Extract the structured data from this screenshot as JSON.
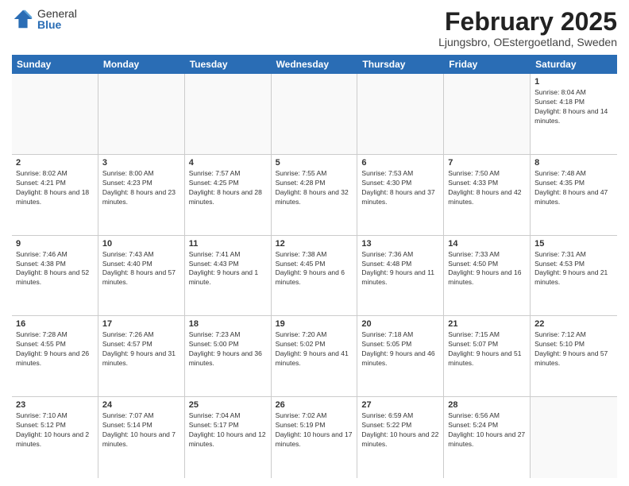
{
  "header": {
    "logo_general": "General",
    "logo_blue": "Blue",
    "month_year": "February 2025",
    "location": "Ljungsbro, OEstergoetland, Sweden"
  },
  "days_of_week": [
    "Sunday",
    "Monday",
    "Tuesday",
    "Wednesday",
    "Thursday",
    "Friday",
    "Saturday"
  ],
  "weeks": [
    [
      {
        "day": "",
        "info": ""
      },
      {
        "day": "",
        "info": ""
      },
      {
        "day": "",
        "info": ""
      },
      {
        "day": "",
        "info": ""
      },
      {
        "day": "",
        "info": ""
      },
      {
        "day": "",
        "info": ""
      },
      {
        "day": "1",
        "info": "Sunrise: 8:04 AM\nSunset: 4:18 PM\nDaylight: 8 hours and 14 minutes."
      }
    ],
    [
      {
        "day": "2",
        "info": "Sunrise: 8:02 AM\nSunset: 4:21 PM\nDaylight: 8 hours and 18 minutes."
      },
      {
        "day": "3",
        "info": "Sunrise: 8:00 AM\nSunset: 4:23 PM\nDaylight: 8 hours and 23 minutes."
      },
      {
        "day": "4",
        "info": "Sunrise: 7:57 AM\nSunset: 4:25 PM\nDaylight: 8 hours and 28 minutes."
      },
      {
        "day": "5",
        "info": "Sunrise: 7:55 AM\nSunset: 4:28 PM\nDaylight: 8 hours and 32 minutes."
      },
      {
        "day": "6",
        "info": "Sunrise: 7:53 AM\nSunset: 4:30 PM\nDaylight: 8 hours and 37 minutes."
      },
      {
        "day": "7",
        "info": "Sunrise: 7:50 AM\nSunset: 4:33 PM\nDaylight: 8 hours and 42 minutes."
      },
      {
        "day": "8",
        "info": "Sunrise: 7:48 AM\nSunset: 4:35 PM\nDaylight: 8 hours and 47 minutes."
      }
    ],
    [
      {
        "day": "9",
        "info": "Sunrise: 7:46 AM\nSunset: 4:38 PM\nDaylight: 8 hours and 52 minutes."
      },
      {
        "day": "10",
        "info": "Sunrise: 7:43 AM\nSunset: 4:40 PM\nDaylight: 8 hours and 57 minutes."
      },
      {
        "day": "11",
        "info": "Sunrise: 7:41 AM\nSunset: 4:43 PM\nDaylight: 9 hours and 1 minute."
      },
      {
        "day": "12",
        "info": "Sunrise: 7:38 AM\nSunset: 4:45 PM\nDaylight: 9 hours and 6 minutes."
      },
      {
        "day": "13",
        "info": "Sunrise: 7:36 AM\nSunset: 4:48 PM\nDaylight: 9 hours and 11 minutes."
      },
      {
        "day": "14",
        "info": "Sunrise: 7:33 AM\nSunset: 4:50 PM\nDaylight: 9 hours and 16 minutes."
      },
      {
        "day": "15",
        "info": "Sunrise: 7:31 AM\nSunset: 4:53 PM\nDaylight: 9 hours and 21 minutes."
      }
    ],
    [
      {
        "day": "16",
        "info": "Sunrise: 7:28 AM\nSunset: 4:55 PM\nDaylight: 9 hours and 26 minutes."
      },
      {
        "day": "17",
        "info": "Sunrise: 7:26 AM\nSunset: 4:57 PM\nDaylight: 9 hours and 31 minutes."
      },
      {
        "day": "18",
        "info": "Sunrise: 7:23 AM\nSunset: 5:00 PM\nDaylight: 9 hours and 36 minutes."
      },
      {
        "day": "19",
        "info": "Sunrise: 7:20 AM\nSunset: 5:02 PM\nDaylight: 9 hours and 41 minutes."
      },
      {
        "day": "20",
        "info": "Sunrise: 7:18 AM\nSunset: 5:05 PM\nDaylight: 9 hours and 46 minutes."
      },
      {
        "day": "21",
        "info": "Sunrise: 7:15 AM\nSunset: 5:07 PM\nDaylight: 9 hours and 51 minutes."
      },
      {
        "day": "22",
        "info": "Sunrise: 7:12 AM\nSunset: 5:10 PM\nDaylight: 9 hours and 57 minutes."
      }
    ],
    [
      {
        "day": "23",
        "info": "Sunrise: 7:10 AM\nSunset: 5:12 PM\nDaylight: 10 hours and 2 minutes."
      },
      {
        "day": "24",
        "info": "Sunrise: 7:07 AM\nSunset: 5:14 PM\nDaylight: 10 hours and 7 minutes."
      },
      {
        "day": "25",
        "info": "Sunrise: 7:04 AM\nSunset: 5:17 PM\nDaylight: 10 hours and 12 minutes."
      },
      {
        "day": "26",
        "info": "Sunrise: 7:02 AM\nSunset: 5:19 PM\nDaylight: 10 hours and 17 minutes."
      },
      {
        "day": "27",
        "info": "Sunrise: 6:59 AM\nSunset: 5:22 PM\nDaylight: 10 hours and 22 minutes."
      },
      {
        "day": "28",
        "info": "Sunrise: 6:56 AM\nSunset: 5:24 PM\nDaylight: 10 hours and 27 minutes."
      },
      {
        "day": "",
        "info": ""
      }
    ]
  ]
}
